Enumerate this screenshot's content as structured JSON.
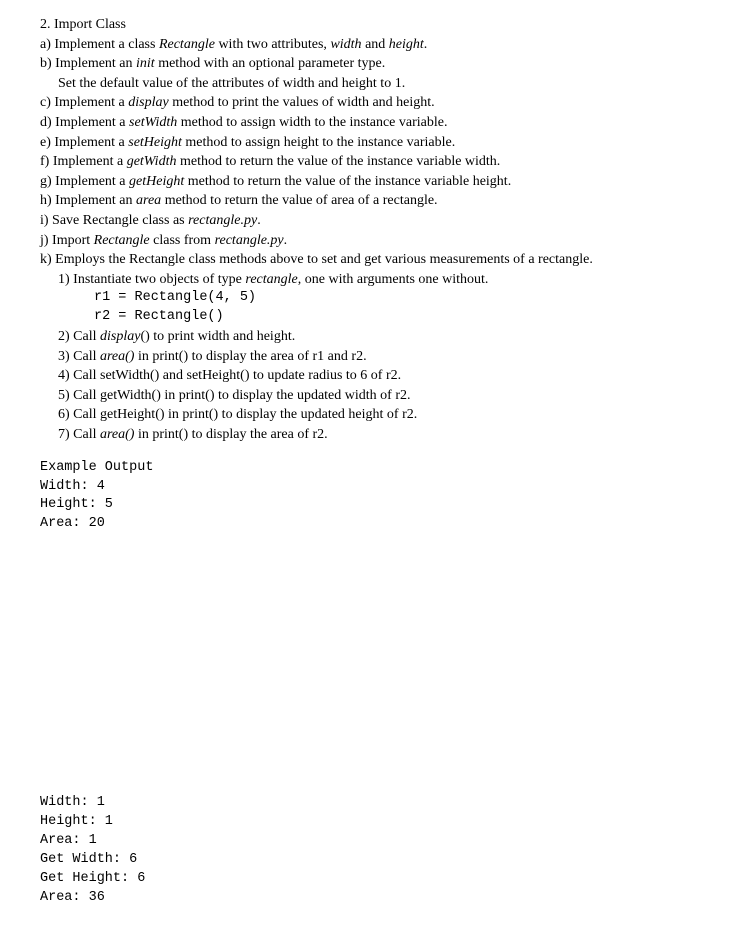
{
  "title": "2. Import Class",
  "a": {
    "prefix": "a) Implement a class ",
    "em1": "Rectangle",
    "mid": " with two attributes, ",
    "em2": "width",
    "mid2": " and ",
    "em3": "height",
    "suffix": "."
  },
  "b": {
    "prefix": "b) Implement an ",
    "em1": "init",
    "suffix": " method with an optional parameter type."
  },
  "b2": "Set the default value of the attributes of width and height to 1.",
  "c": {
    "prefix": "c) Implement a ",
    "em1": "display",
    "suffix": " method to print the values of width and height."
  },
  "d": {
    "prefix": "d) Implement a ",
    "em1": "setWidth",
    "suffix": " method to assign width to the instance variable."
  },
  "e": {
    "prefix": "e) Implement a ",
    "em1": "setHeight",
    "suffix": " method to assign height to the instance variable."
  },
  "f": {
    "prefix": "f) Implement a ",
    "em1": "getWidth",
    "suffix": " method to return the value of the instance variable width."
  },
  "g": {
    "prefix": "g) Implement a ",
    "em1": "getHeight",
    "suffix": " method to return the value of the instance variable height."
  },
  "h": {
    "prefix": "h) Implement an ",
    "em1": "area",
    "suffix": " method to return the value of area of a rectangle."
  },
  "i": {
    "prefix": "i) Save Rectangle class as ",
    "em1": "rectangle.py",
    "suffix": "."
  },
  "j": {
    "prefix": "j) Import ",
    "em1": "Rectangle",
    "mid": " class from ",
    "em2": "rectangle.py",
    "suffix": "."
  },
  "k": "k) Employs the Rectangle class methods above to set and get various measurements of a rectangle.",
  "k1": {
    "prefix": "1) Instantiate two objects of type ",
    "em1": "rectangle",
    "suffix": ", one with arguments one without."
  },
  "code1": "r1 = Rectangle(4, 5)",
  "code2": "r2 = Rectangle()",
  "k2": {
    "prefix": "2) Call ",
    "em1": "display",
    "suffix": "() to print width and height."
  },
  "k3": {
    "prefix": "3) Call ",
    "em1": "area()",
    "suffix": " in print() to display the area of r1 and r2."
  },
  "k4": "4) Call setWidth() and setHeight() to update radius to 6 of r2.",
  "k5": "5) Call getWidth() in print() to display the updated width of r2.",
  "k6": "6) Call getHeight() in print() to display the updated height of r2.",
  "k7": {
    "prefix": "7) Call ",
    "em1": "area()",
    "suffix": " in print() to display the area of r2."
  },
  "example_heading": "Example Output",
  "out1": "Width: 4",
  "out2": "Height: 5",
  "out3": "Area: 20",
  "out4": "Width: 1",
  "out5": "Height: 1",
  "out6": "Area: 1",
  "out7": "Get Width: 6",
  "out8": "Get Height: 6",
  "out9": "Area: 36"
}
